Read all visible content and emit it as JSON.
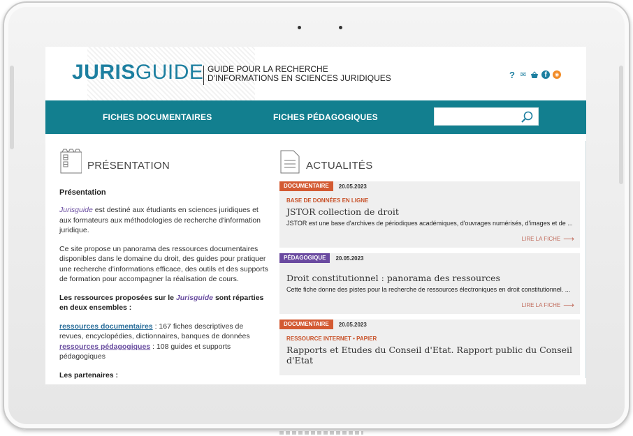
{
  "site": {
    "logo_bold": "JURIS",
    "logo_light": "GUIDE",
    "tagline_line1": "GUIDE POUR LA RECHERCHE",
    "tagline_line2": "D'INFORMATIONS EN SCIENCES JURIDIQUES",
    "accent_color": "#127f8f"
  },
  "header_icons": {
    "help": "?",
    "mail": "✉",
    "fb": "f",
    "rss": "◉"
  },
  "nav": {
    "items": [
      "FICHES DOCUMENTAIRES",
      "FICHES PÉDAGOGIQUES"
    ],
    "search_placeholder": ""
  },
  "presentation": {
    "section_title": "PRÉSENTATION",
    "heading": "Présentation",
    "p1_brand": "Jurisguide",
    "p1_rest": " est destiné aux étudiants en sciences juridiques et aux formateurs aux méthodologies de recherche d'information juridique.",
    "p2": "Ce site propose un panorama des ressources documentaires disponibles dans le domaine du droit, des guides pour pratiquer une recherche d'informations efficace, des outils et des supports de formation pour accompagner la réalisation de cours.",
    "p3_start": "Les ressources proposées sur le ",
    "p3_brand": "Jurisguide",
    "p3_end": " sont réparties en deux ensembles :",
    "res_doc_link": "ressources documentaires",
    "res_doc_text": " : 167 fiches descriptives de revues, encyclopédies, dictionnaires, banques de données",
    "res_ped_link": "ressources pédagogiques",
    "res_ped_text": " : 108 guides et supports pédagogiques",
    "partners": "Les partenaires :"
  },
  "news": {
    "section_title": "ACTUALITÉS",
    "read_more": "LIRE LA FICHE",
    "items": [
      {
        "badge": "DOCUMENTAIRE",
        "date": "20.05.2023",
        "kind": "BASE DE DONNÉES EN LIGNE",
        "title": "JSTOR collection de droit",
        "desc": "JSTOR est une base d'archives de périodiques académiques, d'ouvrages numérisés, d'images et de ..."
      },
      {
        "badge": "PÉDAGOGIQUE",
        "date": "20.05.2023",
        "kind": "",
        "title": "Droit constitutionnel : panorama des ressources",
        "desc": "Cette fiche donne des pistes pour la recherche de ressources électroniques en droit constitutionnel. ..."
      },
      {
        "badge": "DOCUMENTAIRE",
        "date": "20.05.2023",
        "kind": "RESSOURCE INTERNET • PAPIER",
        "title": "Rapports et Etudes du Conseil d'Etat. Rapport public du Conseil d'Etat",
        "desc": ""
      }
    ]
  }
}
